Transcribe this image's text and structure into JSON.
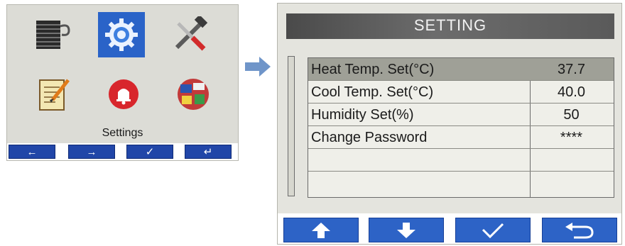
{
  "left_panel": {
    "caption": "Settings",
    "icons": [
      "blinds-icon",
      "gear-icon",
      "tools-icon",
      "notepad-icon",
      "alarm-bell-icon",
      "language-globe-icon"
    ],
    "selected_icon": "gear-icon",
    "nav": [
      "left-arrow-icon",
      "right-arrow-icon",
      "checkmark-icon",
      "return-icon"
    ]
  },
  "right_panel": {
    "title": "SETTING",
    "rows": [
      {
        "label": "Heat Temp. Set(°C)",
        "value": "37.7",
        "highlighted": true
      },
      {
        "label": "Cool Temp. Set(°C)",
        "value": "40.0"
      },
      {
        "label": "Humidity Set(%)",
        "value": "50"
      },
      {
        "label": "Change Password",
        "value": "****"
      },
      {
        "label": "",
        "value": ""
      },
      {
        "label": "",
        "value": ""
      }
    ],
    "nav": [
      "up-arrow-icon",
      "down-arrow-icon",
      "checkmark-icon",
      "return-icon"
    ]
  },
  "colors": {
    "accent_blue": "#2d63c6",
    "highlight": "#9fa097",
    "title_bar": "#5a5a5a"
  }
}
